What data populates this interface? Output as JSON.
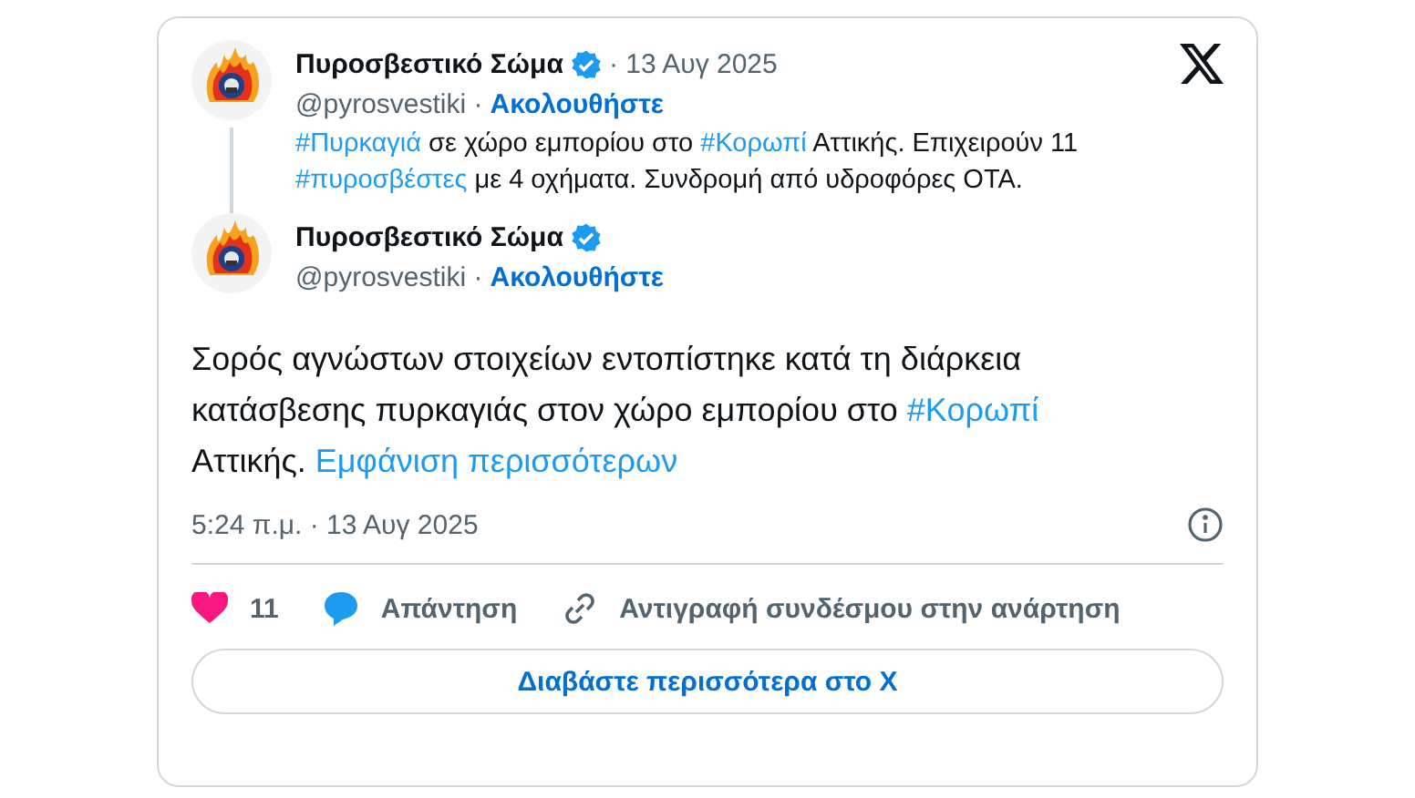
{
  "parent_tweet": {
    "author": "Πυροσβεστικό Σώμα",
    "verified": true,
    "date": "· 13 Αυγ 2025",
    "handle": "@pyrosvestiki ·",
    "follow": "Ακολουθήστε",
    "text": [
      {
        "kind": "hashtag",
        "text": "#Πυρκαγιά"
      },
      {
        "kind": "text",
        "text": " σε χώρο εμπορίου στο "
      },
      {
        "kind": "hashtag",
        "text": "#Κορωπί"
      },
      {
        "kind": "text",
        "text": " Αττικής. Επιχειρούν 11 "
      },
      {
        "kind": "hashtag",
        "text": "#πυροσβέστες"
      },
      {
        "kind": "text",
        "text": " με 4 οχήματα. Συνδρομή από υδροφόρες ΟΤΑ."
      }
    ]
  },
  "tweet": {
    "author": "Πυροσβεστικό Σώμα",
    "verified": true,
    "handle": "@pyrosvestiki ·",
    "follow": "Ακολουθήστε",
    "text": [
      {
        "kind": "text",
        "text": "Σορός αγνώστων στοιχείων εντοπίστηκε κατά τη διάρκεια κατάσβεσης πυρκαγιάς στον χώρο εμπορίου στο "
      },
      {
        "kind": "hashtag",
        "text": "#Κορωπί"
      },
      {
        "kind": "text",
        "text": " Αττικής. "
      },
      {
        "kind": "more",
        "text": "Εμφάνιση περισσότερων"
      }
    ],
    "timestamp": "5:24 π.μ. · 13 Αυγ 2025"
  },
  "actions": [
    {
      "kind": "like",
      "label": "11"
    },
    {
      "kind": "reply",
      "label": "Απάντηση"
    },
    {
      "kind": "copy",
      "label": "Αντιγραφή συνδέσμου στην ανάρτηση"
    }
  ],
  "read_more": "Διαβάστε περισσότερα στο X"
}
